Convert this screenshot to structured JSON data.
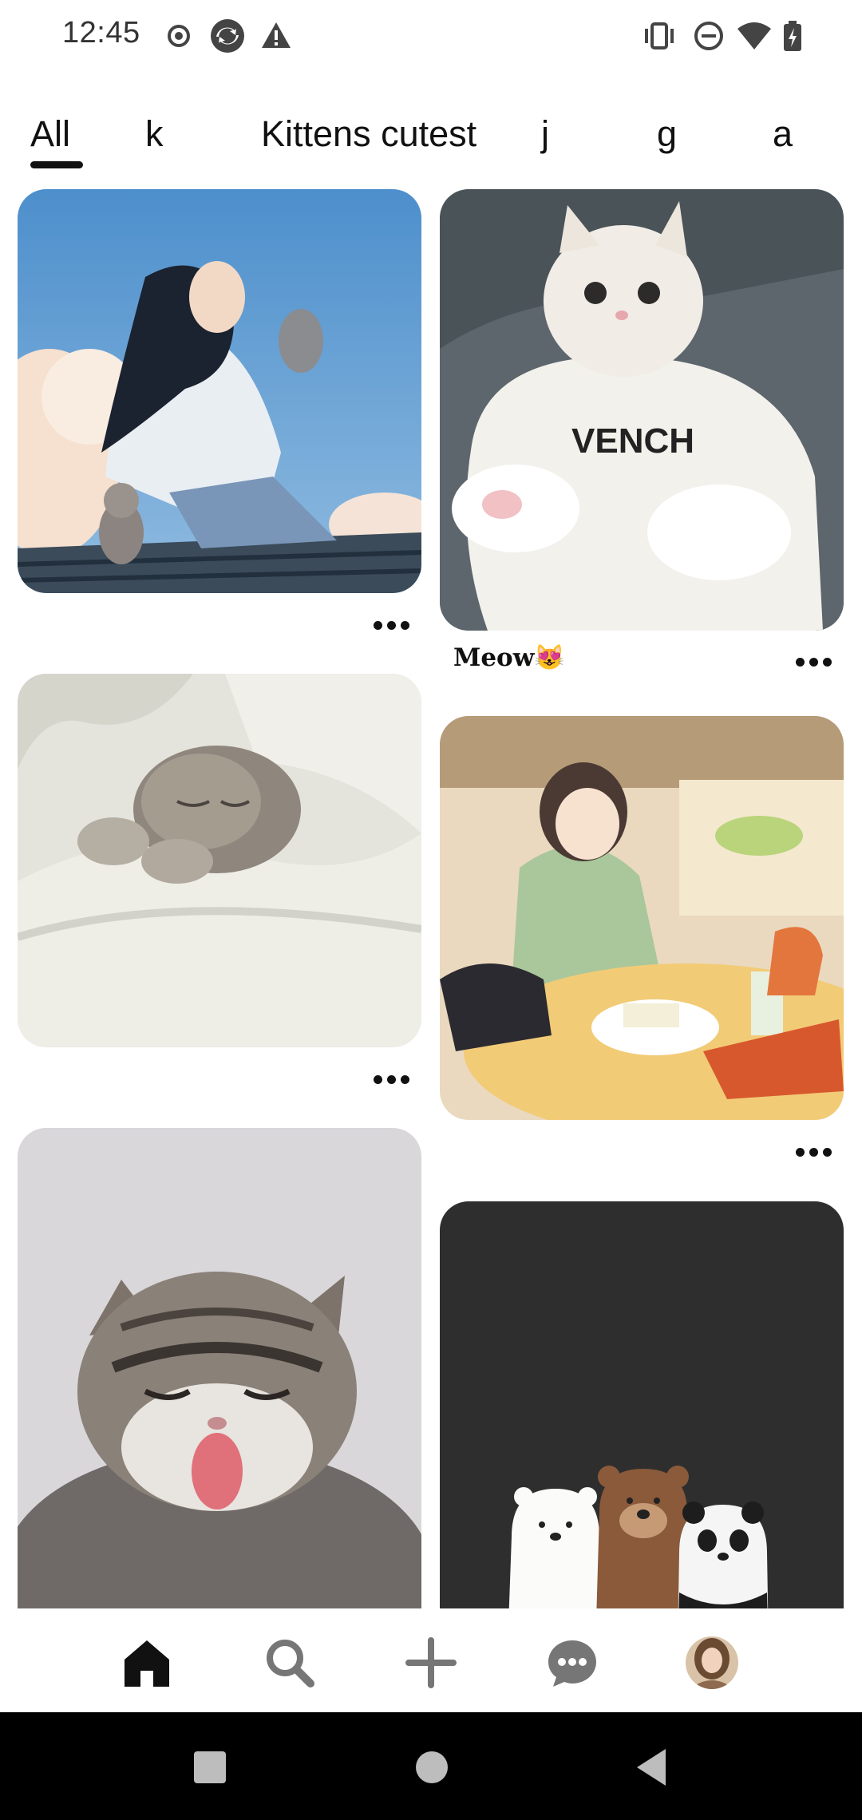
{
  "status_bar": {
    "time": "12:45",
    "left_icons": [
      "record-icon",
      "sync-icon",
      "warning-icon"
    ],
    "right_icons": [
      "vibrate-icon",
      "do-not-disturb-icon",
      "wifi-icon",
      "battery-charging-icon"
    ]
  },
  "tabs": [
    {
      "label": "All",
      "selected": true
    },
    {
      "label": "k",
      "selected": false
    },
    {
      "label": "Kittens cutest",
      "selected": false
    },
    {
      "label": "j",
      "selected": false
    },
    {
      "label": "g",
      "selected": false
    },
    {
      "label": "a",
      "selected": false
    }
  ],
  "pins": [
    {
      "id": "anime-girl-cats-roof",
      "column": "left",
      "title": ""
    },
    {
      "id": "white-kitten-sweater",
      "column": "right",
      "title": "Meow😻"
    },
    {
      "id": "sleeping-kitten-bed",
      "column": "left",
      "title": ""
    },
    {
      "id": "anime-girl-breakfast",
      "column": "right",
      "title": ""
    },
    {
      "id": "yawning-tabby-kitten",
      "column": "left",
      "title": ""
    },
    {
      "id": "we-bare-bears",
      "column": "right",
      "title": ""
    }
  ],
  "bottom_nav": [
    {
      "name": "home",
      "icon": "home-icon",
      "active": true
    },
    {
      "name": "search",
      "icon": "search-icon",
      "active": false
    },
    {
      "name": "create",
      "icon": "plus-icon",
      "active": false
    },
    {
      "name": "messages",
      "icon": "chat-icon",
      "active": false
    },
    {
      "name": "profile",
      "icon": "avatar",
      "active": false
    }
  ],
  "system_nav": [
    "recents-button",
    "home-button",
    "back-button"
  ],
  "colors": {
    "background": "#ffffff",
    "text": "#111111",
    "nav_icon_active": "#111111",
    "nav_icon_inactive": "#767676",
    "system_nav": "#000000"
  }
}
